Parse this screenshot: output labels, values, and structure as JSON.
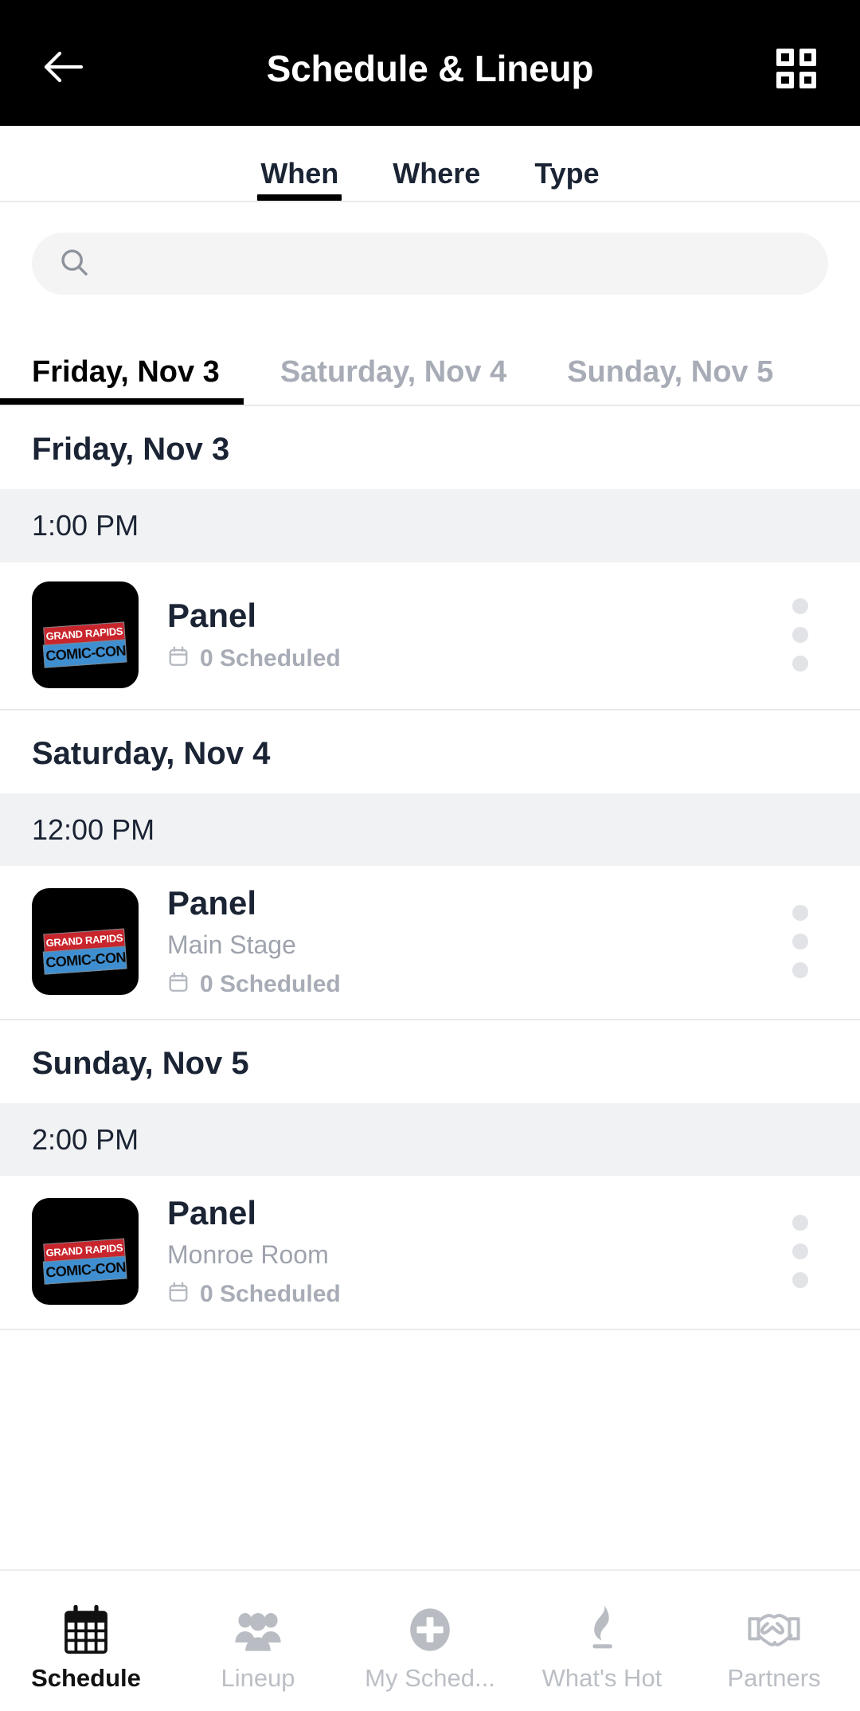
{
  "statusbar": {
    "clipped": ""
  },
  "appbar": {
    "title": "Schedule & Lineup",
    "back_icon": "arrow-left-icon",
    "grid_icon": "grid-view-icon"
  },
  "filter_tabs": [
    {
      "label": "When",
      "active": true
    },
    {
      "label": "Where",
      "active": false
    },
    {
      "label": "Type",
      "active": false
    }
  ],
  "search": {
    "icon": "search-icon",
    "value": "",
    "placeholder": ""
  },
  "day_tabs": [
    {
      "label": "Friday, Nov 3",
      "active": true
    },
    {
      "label": "Saturday, Nov 4",
      "active": false
    },
    {
      "label": "Sunday, Nov 5",
      "active": false
    }
  ],
  "sections": [
    {
      "day": "Friday, Nov 3",
      "time": "1:00 PM",
      "event": {
        "title": "Panel",
        "venue": "",
        "scheduled": "0 Scheduled",
        "calendar_icon": "calendar-icon",
        "menu_icon": "kebab-menu-icon",
        "thumb_logo_line1": "GRAND RAPIDS",
        "thumb_logo_line2": "COMIC-CON"
      }
    },
    {
      "day": "Saturday, Nov 4",
      "time": "12:00 PM",
      "event": {
        "title": "Panel",
        "venue": "Main Stage",
        "scheduled": "0 Scheduled",
        "calendar_icon": "calendar-icon",
        "menu_icon": "kebab-menu-icon",
        "thumb_logo_line1": "GRAND RAPIDS",
        "thumb_logo_line2": "COMIC-CON"
      }
    },
    {
      "day": "Sunday, Nov 5",
      "time": "2:00 PM",
      "event": {
        "title": "Panel",
        "venue": "Monroe Room",
        "scheduled": "0 Scheduled",
        "calendar_icon": "calendar-icon",
        "menu_icon": "kebab-menu-icon",
        "thumb_logo_line1": "GRAND RAPIDS",
        "thumb_logo_line2": "COMIC-CON"
      }
    }
  ],
  "bottom_nav": [
    {
      "label": "Schedule",
      "icon": "calendar-icon",
      "active": true
    },
    {
      "label": "Lineup",
      "icon": "people-icon",
      "active": false
    },
    {
      "label": "My Sched...",
      "icon": "plus-circle-icon",
      "active": false
    },
    {
      "label": "What's Hot",
      "icon": "flame-icon",
      "active": false
    },
    {
      "label": "Partners",
      "icon": "handshake-icon",
      "active": false
    }
  ],
  "colors": {
    "appbar_bg": "#000000",
    "text_primary": "#1b2434",
    "text_muted": "#9ea3ad",
    "time_row_bg": "#f1f2f4",
    "search_bg": "#f4f4f5",
    "divider": "#e9eaec",
    "logo_red": "#c9252c",
    "logo_blue": "#3f8fd0"
  }
}
